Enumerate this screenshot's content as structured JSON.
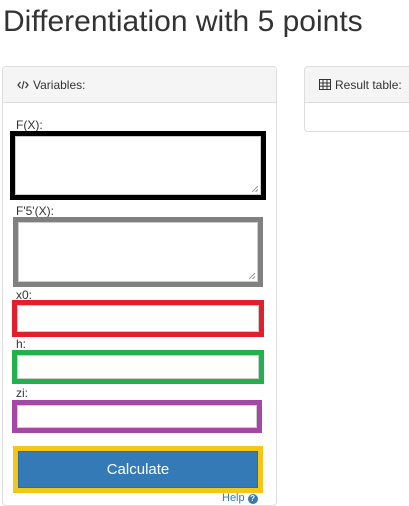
{
  "page": {
    "title": "Differentiation with 5 points"
  },
  "variables_panel": {
    "title": "Variables:",
    "icon": "code-icon"
  },
  "result_panel": {
    "title": "Result table:",
    "icon": "table-icon"
  },
  "fields": {
    "fx": {
      "label": "F(X):",
      "value": "",
      "highlight": "#000000"
    },
    "f5x": {
      "label": "F'5'(X):",
      "value": "",
      "highlight": "#808080"
    },
    "x0": {
      "label": "x0:",
      "value": "",
      "highlight": "#e0202a"
    },
    "h": {
      "label": "h:",
      "value": "",
      "highlight": "#22b14c"
    },
    "zi": {
      "label": "zi:",
      "value": "",
      "highlight": "#a349a4"
    }
  },
  "actions": {
    "calculate_label": "Calculate",
    "calculate_highlight": "#f5c518",
    "help_label": "Help"
  },
  "colors": {
    "primary": "#337ab7"
  }
}
